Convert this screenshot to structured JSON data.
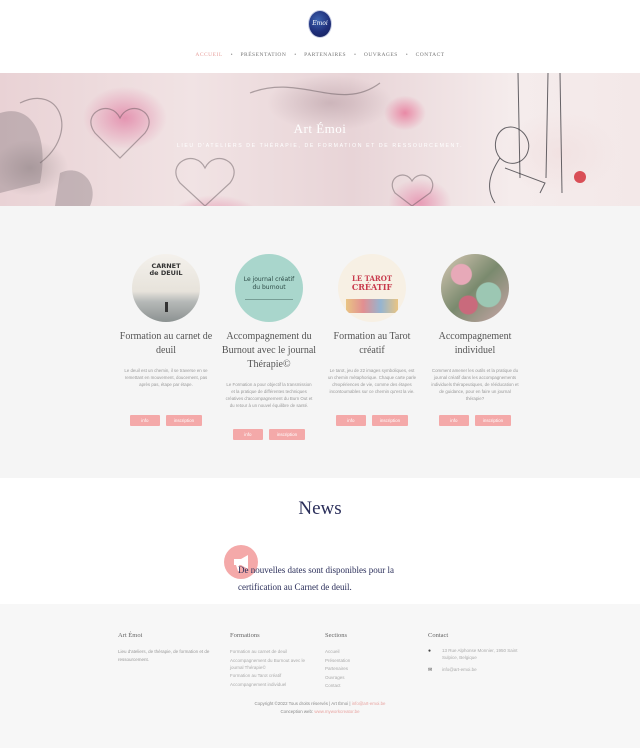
{
  "header": {
    "logo_text": "Emoi",
    "nav": [
      {
        "label": "ACCUEIL",
        "active": true
      },
      {
        "label": "PRÉSENTATION",
        "active": false
      },
      {
        "label": "PARTENAIRES",
        "active": false
      },
      {
        "label": "OUVRAGES",
        "active": false
      },
      {
        "label": "CONTACT",
        "active": false
      }
    ],
    "nav_separator": "•"
  },
  "hero": {
    "title": "Art Émoi",
    "subtitle": "Lieu d'ateliers de thérapie, de formation et de ressourcement."
  },
  "services": [
    {
      "title": "Formation au carnet de deuil",
      "desc": "Le deuil est un chemin, il se traverse en se remettant en mouvement, doucement, pas après pas, étape par étape.",
      "book_text": [
        "CARNET",
        "de DEUIL"
      ],
      "info": "info",
      "inscription": "inscription"
    },
    {
      "title": "Accompagnement du Burnout avec le journal Thérapie©",
      "desc": "Le Formation a pour objectif la transmission et la pratique de différentes techniques créatives d'accompagnement du Burn Out et du retour à un nouvel équilibre de santé.",
      "book_text": [
        "Le journal créatif",
        "du burnout"
      ],
      "info": "info",
      "inscription": "inscription"
    },
    {
      "title": "Formation au Tarot créatif",
      "desc": "Le tarot, jeu de 22 images symboliques, est un chemin métaphorique. Chaque carte parle d'expériences de vie, comme des étapes incontournables sur ce chemin qu'est la vie.",
      "book_text": [
        "LE TAROT",
        "CRÉATIF"
      ],
      "info": "info",
      "inscription": "inscription"
    },
    {
      "title": "Accompagnement individuel",
      "desc": "Comment amener les outils et la pratique du journal créatif dans les accompagnements individuels thérapeutiques, de rééducation et de guidance, pour en faire un journal thérapie?",
      "book_text": [],
      "info": "info",
      "inscription": "inscription"
    }
  ],
  "news": {
    "title": "News",
    "text": "De nouvelles dates sont disponibles pour la certification au Carnet de deuil."
  },
  "footer": {
    "col1": {
      "title": "Art Émoi",
      "text": "Lieu d'ateliers, de thérapie, de formation et de ressourcement."
    },
    "col2": {
      "title": "Formations",
      "links": [
        "Formation au carnet de deuil",
        "Accompagnement du Burnout avec le journal Thérapie©",
        "Formation au Tarot créatif",
        "Accompagnement individuel"
      ]
    },
    "col3": {
      "title": "Sections",
      "links": [
        "Accueil",
        "Présentation",
        "Partenaires",
        "Ouvrages",
        "Contact"
      ]
    },
    "col4": {
      "title": "Contact",
      "address": "13 Rue Alphonse Monnier, 1950 Saint Sulpice, Belgique",
      "email": "info@art-emoi.be"
    },
    "copyright": "Copyright ©2022 Tous droits réservés | Art Émoi |",
    "copyright_email": "info@art-emoi.be",
    "credit": "Conception web:",
    "credit_link": "www.myworkcreator.be"
  },
  "colors": {
    "accent": "#f4a9a9",
    "navy": "#2a2e5a",
    "nav_active": "#e8a3a0"
  },
  "icons": {
    "news": "megaphone-icon",
    "address": "location-pin-icon",
    "email": "envelope-icon"
  }
}
